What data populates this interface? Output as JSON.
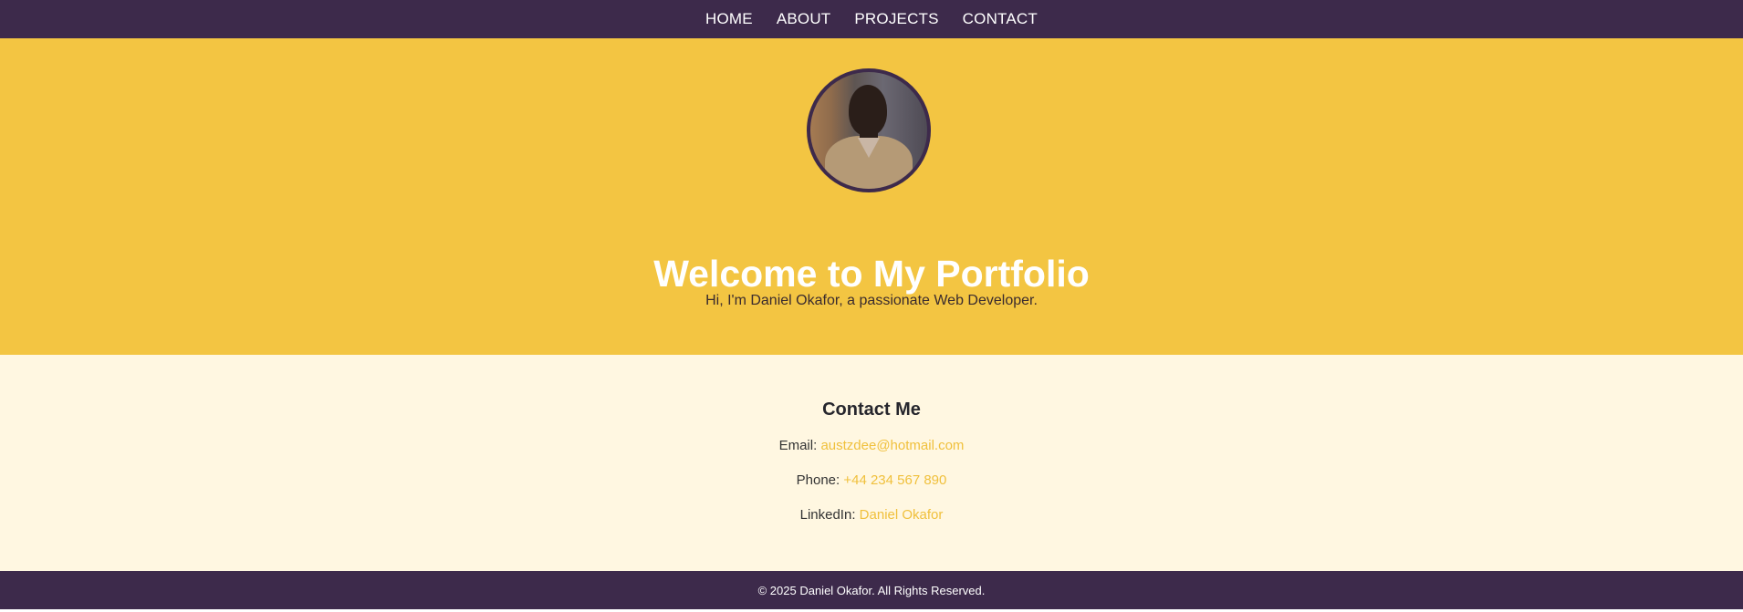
{
  "nav": {
    "items": [
      {
        "label": "HOME"
      },
      {
        "label": "ABOUT"
      },
      {
        "label": "PROJECTS"
      },
      {
        "label": "CONTACT"
      }
    ]
  },
  "hero": {
    "title": "Welcome to My Portfolio",
    "subtitle": "Hi, I'm Daniel Okafor, a passionate Web Developer."
  },
  "contact": {
    "heading": "Contact Me",
    "email_label": "Email:",
    "email_value": "austzdee@hotmail.com",
    "phone_label": "Phone:",
    "phone_value": "+44 234 567 890",
    "linkedin_label": "LinkedIn:",
    "linkedin_value": "Daniel Okafor"
  },
  "footer": {
    "text": "© 2025 Daniel Okafor. All Rights Reserved."
  },
  "colors": {
    "nav_bg": "#3d2a4b",
    "hero_bg": "#f3c542",
    "contact_bg": "#fff7e1",
    "link": "#f0c03c"
  }
}
